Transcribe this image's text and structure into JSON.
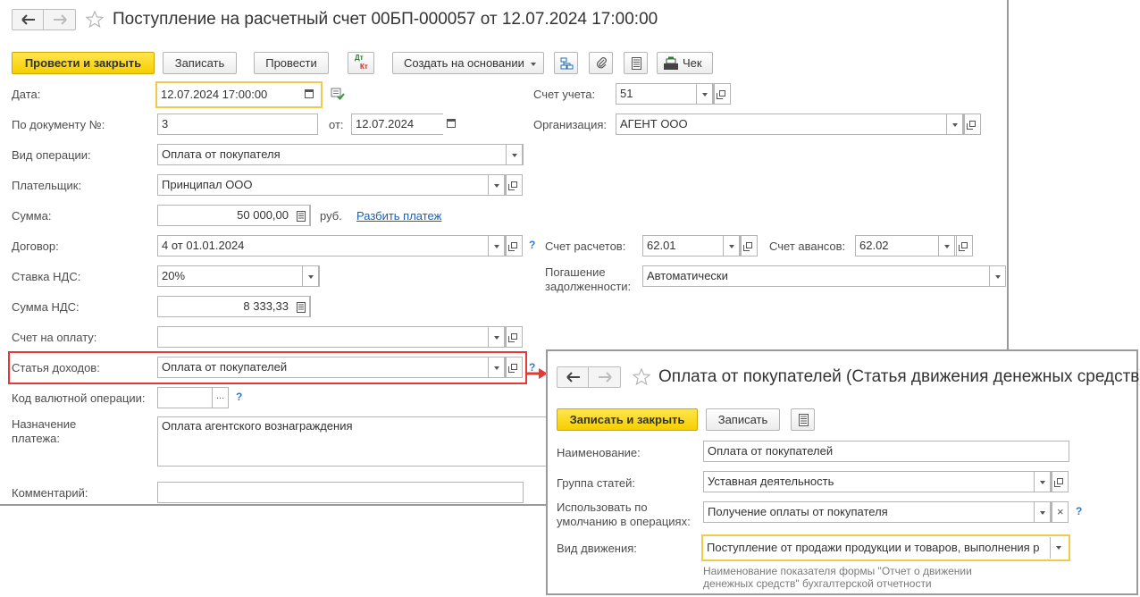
{
  "main": {
    "title": "Поступление на расчетный счет 00БП-000057 от 12.07.2024 17:00:00",
    "toolbar": {
      "post_close": "Провести и закрыть",
      "save": "Записать",
      "post": "Провести",
      "dtkt_top": "Дт",
      "dtkt_bottom": "Кт",
      "create_based": "Создать на основании",
      "receipt": "Чек"
    },
    "fields": {
      "date_label": "Дата:",
      "date_value": "12.07.2024 17:00:00",
      "docnum_label": "По документу №:",
      "docnum_value": "3",
      "from_label": "от:",
      "from_value": "12.07.2024",
      "optype_label": "Вид операции:",
      "optype_value": "Оплата от покупателя",
      "payer_label": "Плательщик:",
      "payer_value": "Принципал ООО",
      "sum_label": "Сумма:",
      "sum_value": "50 000,00",
      "currency": "руб.",
      "split_link": "Разбить платеж",
      "contract_label": "Договор:",
      "contract_value": "4 от 01.01.2024",
      "vat_rate_label": "Ставка НДС:",
      "vat_rate_value": "20%",
      "vat_sum_label": "Сумма НДС:",
      "vat_sum_value": "8 333,33",
      "invoice_label": "Счет на оплату:",
      "invoice_value": "",
      "income_item_label": "Статья доходов:",
      "income_item_value": "Оплата от покупателей",
      "currency_op_label": "Код валютной операции:",
      "currency_op_value": "",
      "purpose_label_1": "Назначение",
      "purpose_label_2": "платежа:",
      "purpose_value": "Оплата агентского вознаграждения",
      "comment_label": "Комментарий:",
      "comment_value": "",
      "account_label": "Счет учета:",
      "account_value": "51",
      "org_label": "Организация:",
      "org_value": "АГЕНТ ООО",
      "settle_acc_label": "Счет расчетов:",
      "settle_acc_value": "62.01",
      "advance_acc_label": "Счет авансов:",
      "advance_acc_value": "62.02",
      "repay_label_1": "Погашение",
      "repay_label_2": "задолженности:",
      "repay_value": "Автоматически",
      "help": "?"
    }
  },
  "sub": {
    "title": "Оплата от покупателей (Статья движения денежных средств)",
    "toolbar": {
      "save_close": "Записать и закрыть",
      "save": "Записать"
    },
    "fields": {
      "name_label": "Наименование:",
      "name_value": "Оплата от покупателей",
      "group_label": "Группа статей:",
      "group_value": "Уставная деятельность",
      "default_label_1": "Использовать по",
      "default_label_2": "умолчанию в операциях:",
      "default_value": "Получение оплаты от покупателя",
      "movement_label": "Вид движения:",
      "movement_value": "Поступление от продажи продукции и товаров, выполнения р",
      "hint_1": "Наименование показателя формы \"Отчет о движении",
      "hint_2": "денежных средств\" бухгалтерской отчетности",
      "help": "?"
    }
  },
  "colors": {
    "primary_button": "#f6cf00",
    "highlight_border": "#e53935",
    "link": "#1a5fb4",
    "focus_border": "#f2c94c"
  }
}
